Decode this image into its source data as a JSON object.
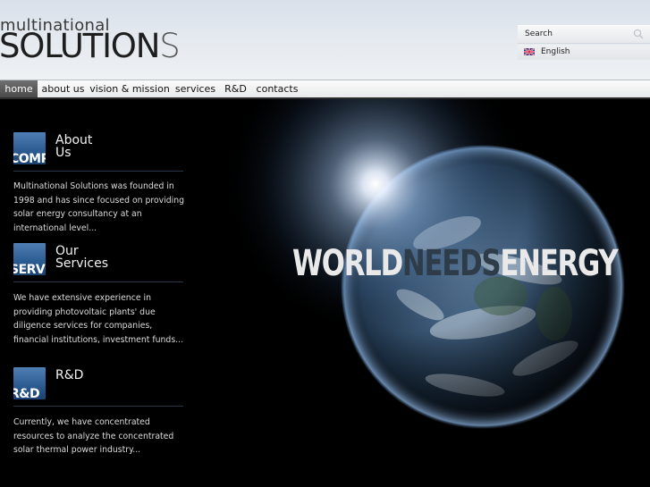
{
  "header": {
    "logo_top": "multinational",
    "logo_main": "SOLUTION",
    "logo_last": "S",
    "search_label": "Search",
    "language_label": "English"
  },
  "nav": {
    "items": [
      {
        "label": "home",
        "active": true
      },
      {
        "label": "about us",
        "active": false
      },
      {
        "label": "vision & mission",
        "active": false
      },
      {
        "label": "services",
        "active": false
      },
      {
        "label": "R&D",
        "active": false
      },
      {
        "label": "contacts",
        "active": false
      }
    ]
  },
  "hero": {
    "word1": "WORLD",
    "word2": "NEEDS",
    "word3": "ENERGY"
  },
  "sections": [
    {
      "icon_text": "COMP",
      "title_line1": "About",
      "title_line2": "Us",
      "text": "Multinational Solutions was founded in 1998 and has since focused on providing solar energy consultancy at an international level..."
    },
    {
      "icon_text": "SERV",
      "title_line1": "Our",
      "title_line2": "Services",
      "text": "We have extensive experience in providing photovoltaic plants' due diligence services for companies, financial institutions, investment funds..."
    },
    {
      "icon_text": "R&D",
      "title_line1": "R&D",
      "title_line2": "",
      "text": "Currently, we have concentrated resources to analyze the concentrated solar thermal power industry..."
    }
  ],
  "colors": {
    "accent_blue": "#2c5d94",
    "nav_active": "#5a5a5a",
    "background": "#000000"
  }
}
